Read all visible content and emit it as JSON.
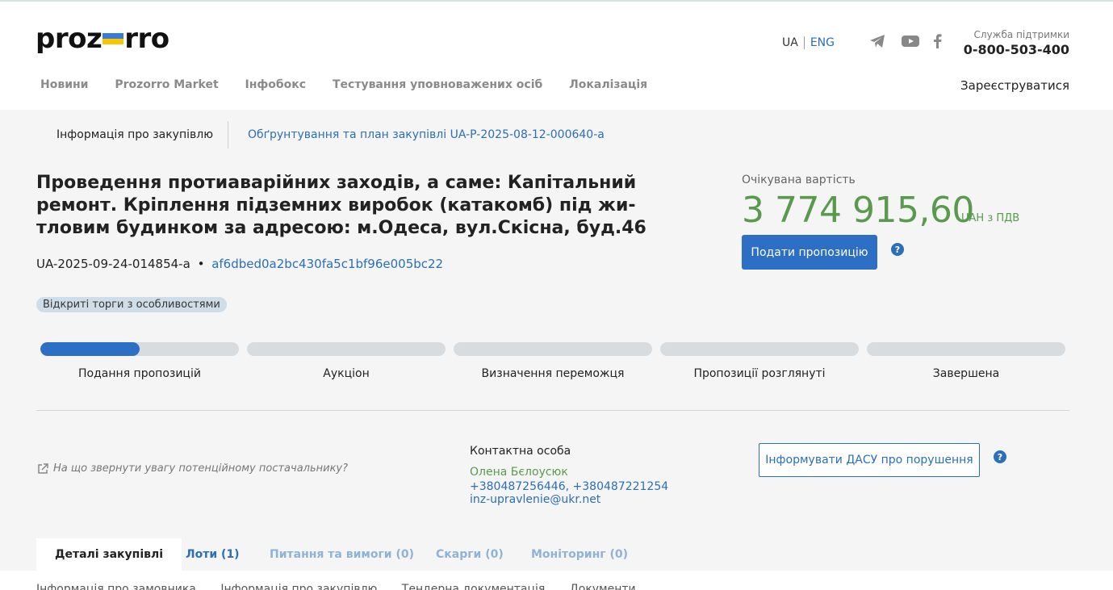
{
  "header": {
    "logo_left": "proz",
    "logo_right": "rro",
    "flag_colors": [
      "#3a7bd5",
      "#f6c700"
    ],
    "lang_ua": "UA",
    "lang_eng": "ENG",
    "social_icons": [
      "telegram-icon",
      "youtube-icon",
      "facebook-icon"
    ],
    "support_label": "Служба підтримки",
    "support_phone": "0-800-503-400",
    "nav": [
      "Новини",
      "Prozorro Market",
      "Інфобокс",
      "Тестування уповноважених осіб",
      "Локалізація"
    ],
    "register": "Зареєструватися"
  },
  "top_tabs": {
    "info": "Інформація про закупівлю",
    "plan": "Обґрунтування та план закупівлі UA-P-2025-08-12-000640-a"
  },
  "tender": {
    "title": "Проведення протиаварійних заходів, а саме: Капітальний ремонт. Кріплення підземних виробок (катакомб) під житловим будинком за адресою: м.Одеса, вул.Скісна, буд.46",
    "title_line1": "Проведення протиаварійних заходів, а саме: Капітальний",
    "title_line2": "ремонт. Кріплення підземних виробок (катакомб) під жи-",
    "title_line3": "тловим будинком за адресою: м.Одеса, вул.Скісна, буд.46",
    "id": "UA-2025-09-24-014854-a",
    "bullet": "•",
    "hash": "af6dbed0a2bc430fa5c1bf96e005bc22",
    "badge": "Відкриті торги з особливостями",
    "value_label": "Очікувана вартість",
    "value": "3 774 915,60",
    "value_unit": "UAH з ПДВ",
    "bid_button": "Подати пропозицію",
    "help": "?"
  },
  "stages": [
    {
      "label": "Подання пропозицій",
      "progress": 0.5
    },
    {
      "label": "Аукціон",
      "progress": 0
    },
    {
      "label": "Визначення переможця",
      "progress": 0
    },
    {
      "label": "Пропозиції розглянуті",
      "progress": 0
    },
    {
      "label": "Завершена",
      "progress": 0
    }
  ],
  "contact": {
    "hint": "На що звернути увагу потенційному постачальнику?",
    "label": "Контактна особа",
    "name": "Олена Бєлоусюк",
    "phones": "+380487256446, +380487221254",
    "email": "inz-upravlenie@ukr.net",
    "dasu_button": "Інформувати ДАСУ про порушення"
  },
  "detail_tabs": [
    "Деталі закупівлі",
    "Лоти (1)",
    "Питання та вимоги (0)",
    "Скарги (0)",
    "Моніторинг (0)"
  ],
  "sub_tabs": [
    "Інформація про замовника",
    "Інформація про закупівлю",
    "Тендерна документація",
    "Документи"
  ],
  "colors": {
    "accent_blue": "#2c6fc4",
    "link_blue": "#2a6fb8",
    "value_green": "#5a9a4e"
  }
}
